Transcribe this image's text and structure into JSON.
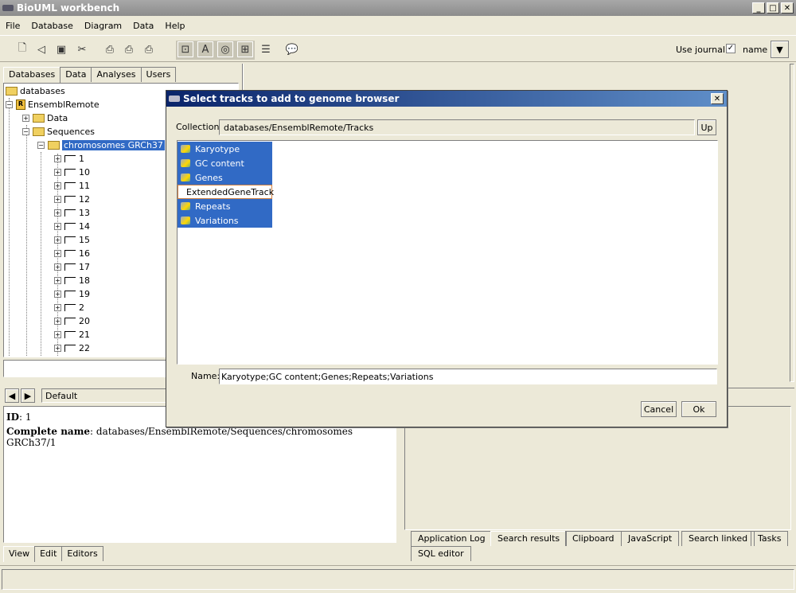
{
  "window": {
    "title": "BioUML workbench"
  },
  "menu": [
    "File",
    "Database",
    "Diagram",
    "Data",
    "Help"
  ],
  "toolbar": {
    "use_journal_label": "Use journal",
    "use_journal_checked": true,
    "name_label": "name"
  },
  "left_tabs": [
    "Databases",
    "Data",
    "Analyses",
    "Users"
  ],
  "tree": {
    "root": "databases",
    "ensembl": "EnsemblRemote",
    "data": "Data",
    "sequences": "Sequences",
    "chromosomes": "chromosomes GRCh37",
    "items": [
      "1",
      "10",
      "11",
      "12",
      "13",
      "14",
      "15",
      "16",
      "17",
      "18",
      "19",
      "2",
      "20",
      "21",
      "22"
    ]
  },
  "info": {
    "default_label": "Default",
    "id_label": "ID",
    "id_value": ": 1",
    "complete_name_label": "Complete name",
    "complete_name_value": ": databases/EnsemblRemote/Sequences/chromosomes GRCh37/1"
  },
  "bottom_left_tabs": [
    "View",
    "Edit",
    "Editors"
  ],
  "right_tabs": [
    "Application Log",
    "Search results",
    "Clipboard",
    "JavaScript",
    "Search linked",
    "Tasks",
    "SQL editor"
  ],
  "dialog": {
    "title": "Select tracks to add to genome browser",
    "collection_label": "Collection:",
    "collection_value": "databases/EnsemblRemote/Tracks",
    "up_label": "Up",
    "tracks": [
      "Karyotype",
      "GC content",
      "Genes",
      "ExtendedGeneTrack",
      "Repeats",
      "Variations"
    ],
    "name_label": "Name:",
    "name_value": "Karyotype;GC content;Genes;Repeats;Variations",
    "cancel_label": "Cancel",
    "ok_label": "Ok"
  }
}
